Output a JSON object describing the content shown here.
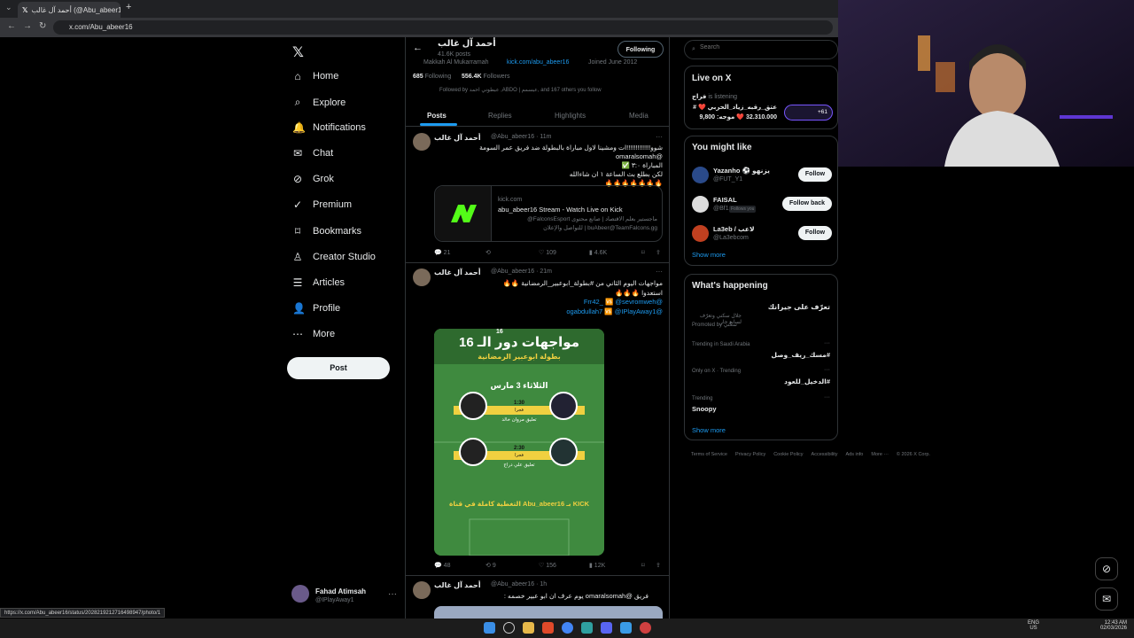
{
  "browser": {
    "tab_title": "أحمد آل غالب (@Abu_abeer16) / X",
    "url": "x.com/Abu_abeer16",
    "status_url": "https://x.com/Abu_abeer16/status/2028219212716498947/photo/1"
  },
  "nav": {
    "items": [
      {
        "label": "Home",
        "icon": "home-icon"
      },
      {
        "label": "Explore",
        "icon": "search-icon"
      },
      {
        "label": "Notifications",
        "icon": "bell-icon"
      },
      {
        "label": "Chat",
        "icon": "envelope-icon"
      },
      {
        "label": "Grok",
        "icon": "grok-icon"
      },
      {
        "label": "Premium",
        "icon": "premium-icon"
      },
      {
        "label": "Bookmarks",
        "icon": "bookmark-icon"
      },
      {
        "label": "Creator Studio",
        "icon": "creator-icon"
      },
      {
        "label": "Articles",
        "icon": "articles-icon"
      },
      {
        "label": "Profile",
        "icon": "profile-icon"
      },
      {
        "label": "More",
        "icon": "more-icon"
      }
    ],
    "post_label": "Post",
    "account": {
      "name": "Fahad Atimsah",
      "handle": "@IPlayAway1"
    }
  },
  "profile": {
    "name": "أحمد آل غالب",
    "posts": "41.6K posts",
    "follow_label": "Following",
    "location": "Makkah Al Mukarramah",
    "link": "kick.com/abu_abeer16",
    "joined": "Joined June 2012",
    "following_count": "685",
    "following_label": "Following",
    "followers_count": "556.4K",
    "followers_label": "Followers",
    "followed_by": "Followed by عبطوني احمد ,ABDO | عبسمم, and 167 others you follow",
    "tabs": [
      "Posts",
      "Replies",
      "Highlights",
      "Media"
    ]
  },
  "tweet1": {
    "name": "أحمد آل غالب",
    "handle": "@Abu_abeer16 · 11m",
    "lines": [
      "شوو!!!!!!!!!!!!!ات ومشينا لاول مباراة بالبطولة ضد فريق عمر السومة @omaralsomah",
      "المباراة ٣:٠ ✅",
      "لكن بطلع بث الساعة ١ ان شاءالله",
      "🔥🔥🔥🔥🔥🔥🔥"
    ],
    "card": {
      "domain": "kick.com",
      "title": "abu_abeer16 Stream - Watch Live on Kick",
      "desc1": "ماجستير بعلم الاقتصاد | صانع محتوى FalconsEsport@",
      "desc2": "buAbeer@TeamFalcons.gg | للتواصل والإعلان"
    },
    "replies": "21",
    "likes": "109",
    "views": "4.6K"
  },
  "tweet2": {
    "name": "أحمد آل غالب",
    "handle": "@Abu_abeer16 · 21m",
    "lines": [
      "مواجهات اليوم الثاني من #بطولة_ابوعبير_الرمضانية 🔥🔥",
      "استعدوا 🔥🔥🔥",
      "@Frr42_ 🆚 @sevromweh",
      "@ogabdullah7 🆚 @IPlayAway1"
    ],
    "image": {
      "title": "مواجهات دور الـ 16",
      "subtitle": "بطولة ابوعبير الرمضانية",
      "date": "الثلاثاء 3 مارس",
      "time1": "1:30",
      "ampm1": "فجرا",
      "comm1": "تعليق مروان خالد",
      "time2": "2:30",
      "ampm2": "فجرا",
      "comm2": "تعليق علي دراج",
      "footer": "التغطية كاملة في قناة Abu_abeer16 بـ KICK",
      "badge": "16"
    },
    "replies": "48",
    "retweets": "9",
    "likes": "156",
    "views": "12K"
  },
  "tweet3": {
    "name": "أحمد آل غالب",
    "handle": "@Abu_abeer16 · 1h",
    "line": "فريق @omaralsomah يوم عرف ان ابو عبير خصمه :"
  },
  "right": {
    "search_placeholder": "Search",
    "live": {
      "title": "Live on X",
      "user": "فراج",
      "status": "is listening",
      "topic": "عتق_رقبه_زياد_الحربي ❤️ #",
      "stats": "32.310.000 ❤️ موجه: 9,800",
      "more": "+61"
    },
    "you_might_like": {
      "title": "You might like",
      "users": [
        {
          "name": "Yazanho ⚽ يزنهو",
          "handle": "@FUT_Y1",
          "button": "Follow"
        },
        {
          "name": "FAISAL",
          "handle": "@Bf1",
          "extra": "Follows you",
          "button": "Follow back"
        },
        {
          "name": "La3eb / لاعب",
          "handle": "@La3ebcom",
          "button": "Follow"
        }
      ],
      "show_more": "Show more"
    },
    "happening": {
      "title": "What's happening",
      "items": [
        {
          "title": "تعرّف على جيرانك",
          "sub": "جلال سكني وتعرّف لسابع جار",
          "meta": "Promoted by سكني"
        },
        {
          "meta": "Trending in Saudi Arabia",
          "title": "#مسك_ريف_وصل"
        },
        {
          "meta": "Only on X · Trending",
          "title": "#الدخيل_للعود"
        },
        {
          "meta": "Trending",
          "title": "Snoopy"
        }
      ],
      "show_more": "Show more"
    },
    "footer": [
      "Terms of Service",
      "Privacy Policy",
      "Cookie Policy",
      "Accessibility",
      "Ads info",
      "More ···",
      "© 2026 X Corp."
    ]
  },
  "taskbar": {
    "time": "12:43 AM",
    "date": "02/03/2026",
    "lang": "ENG",
    "region": "US"
  },
  "colors": {
    "accent": "#1d9bf0",
    "bg": "#000000",
    "border": "#2f3336",
    "pitch": "#3a7d3a"
  }
}
